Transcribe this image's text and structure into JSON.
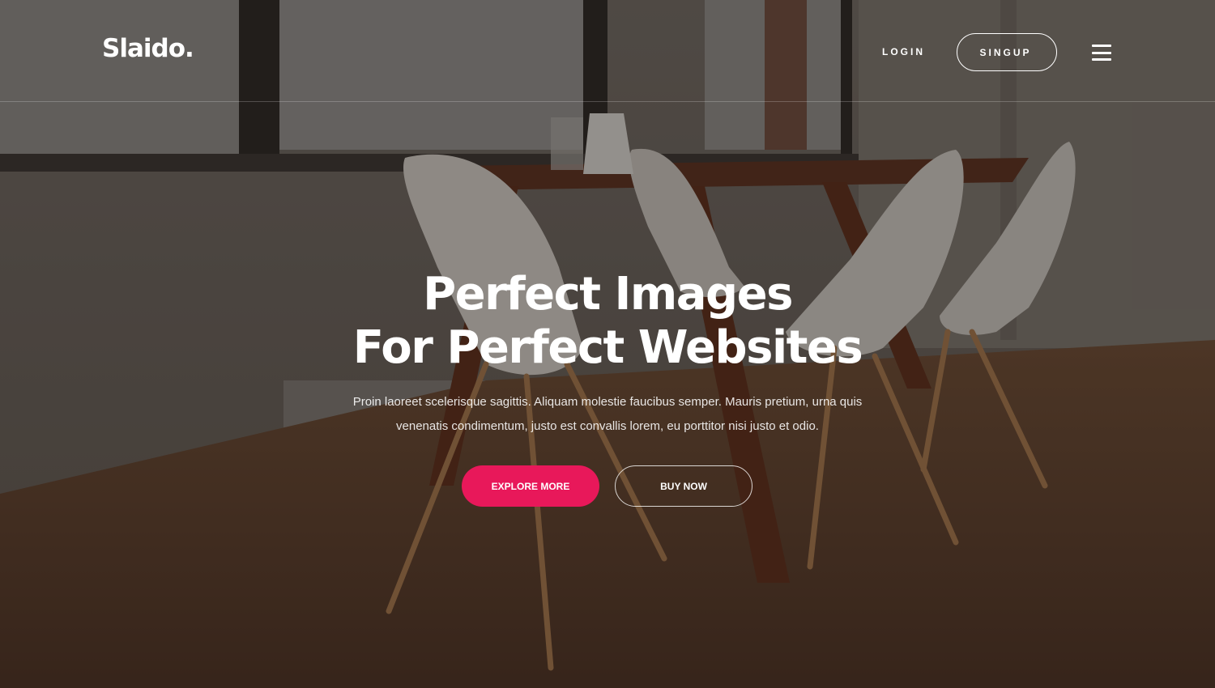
{
  "nav": {
    "brand": "Slaido.",
    "login": "LOGIN",
    "signup": "SINGUP",
    "menu_icon": "hamburger-menu-icon"
  },
  "hero": {
    "title_line1": "Perfect Images",
    "title_line2": "For Perfect Websites",
    "text_line1": "Proin laoreet scelerisque sagittis. Aliquam molestie faucibus semper. Mauris pretium, urna quis",
    "text_line2": "venenatis condimentum, justo est convallis lorem, eu porttitor nisi justo et odio.",
    "primary_button": "EXPLORE MORE",
    "secondary_button": "BUY NOW"
  },
  "colors": {
    "accent": "#e8185a",
    "text": "#ffffff"
  }
}
